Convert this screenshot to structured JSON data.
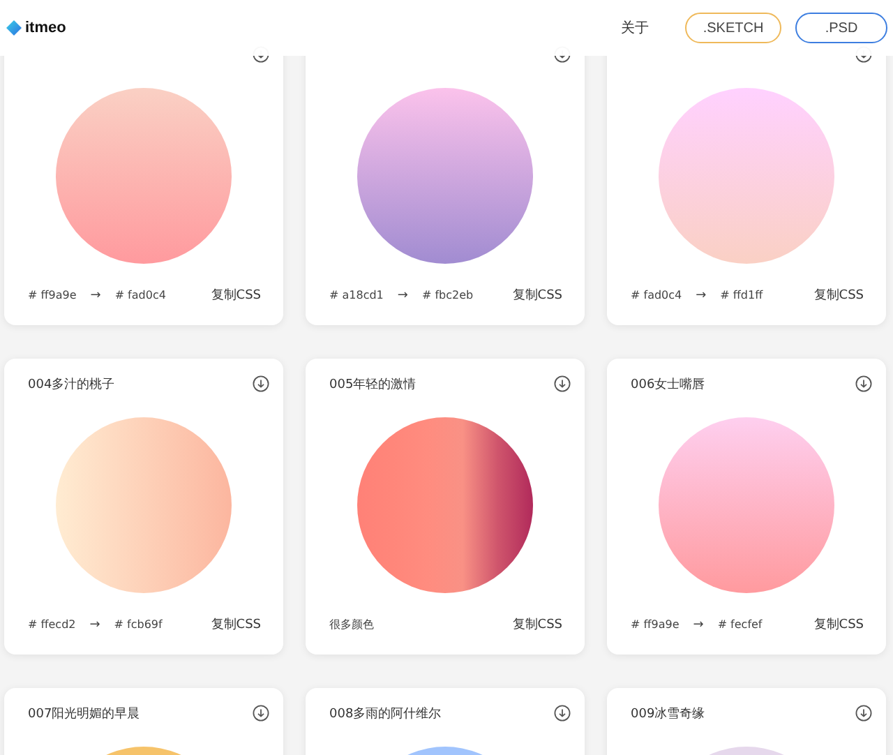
{
  "header": {
    "logo": "itmeo",
    "nav": "关于",
    "buttons": [
      {
        "label": ".SKETCH",
        "kind": "sketch"
      },
      {
        "label": ".PSD",
        "kind": "psd"
      }
    ]
  },
  "cards": [
    {
      "gradient": [
        {
          "color": "#ff9a9e"
        },
        {
          "color": "#fad0c4"
        }
      ],
      "kind": "vertical",
      "footer": {
        "kind": "pair",
        "from": "# ff9a9e",
        "arrow": "→",
        "to": "# fad0c4"
      },
      "copy": "复制CSS"
    },
    {
      "gradient": [
        {
          "color": "#a18cd1"
        },
        {
          "color": "#fbc2eb"
        }
      ],
      "kind": "vertical",
      "footer": {
        "kind": "pair",
        "from": "# a18cd1",
        "arrow": "→",
        "to": "# fbc2eb"
      },
      "copy": "复制CSS"
    },
    {
      "gradient": [
        {
          "color": "#fad0c4"
        },
        {
          "color": "#ffd1ff"
        }
      ],
      "kind": "vertical",
      "footer": {
        "kind": "pair",
        "from": "# fad0c4",
        "arrow": "→",
        "to": "# ffd1ff"
      },
      "copy": "复制CSS"
    },
    {
      "title": "004多汁的桃子",
      "gradient": [
        {
          "color": "#ffecd2"
        },
        {
          "color": "#fcb69f"
        }
      ],
      "kind": "horizontal",
      "footer": {
        "kind": "pair",
        "from": "# ffecd2",
        "arrow": "→",
        "to": "# fcb69f"
      },
      "copy": "复制CSS"
    },
    {
      "title": "005年轻的激情",
      "gradient": [
        {
          "color": "#ff8177"
        },
        {
          "color": "#ff867a"
        },
        {
          "color": "#ff8c7f"
        },
        {
          "color": "#f99185"
        },
        {
          "color": "#cf556c"
        },
        {
          "color": "#b12a5b"
        }
      ],
      "kind": "horizontal",
      "footer": {
        "kind": "note",
        "text": "很多颜色"
      },
      "copy": "复制CSS"
    },
    {
      "title": "006女士嘴唇",
      "gradient": [
        {
          "color": "#ff9a9e"
        },
        {
          "color": "#fecfef"
        }
      ],
      "kind": "vertical",
      "footer": {
        "kind": "pair",
        "from": "# ff9a9e",
        "arrow": "→",
        "to": "# fecfef"
      },
      "copy": "复制CSS"
    },
    {
      "title": "007阳光明媚的早晨",
      "gradient": [
        {
          "color": "#f6c36a"
        }
      ],
      "kind": "vertical"
    },
    {
      "title": "008多雨的阿什维尔",
      "gradient": [
        {
          "color": "#a1c4fd"
        }
      ],
      "kind": "vertical"
    },
    {
      "title": "009冰雪奇缘",
      "gradient": [
        {
          "color": "#e6d8ec"
        }
      ],
      "kind": "vertical"
    }
  ]
}
